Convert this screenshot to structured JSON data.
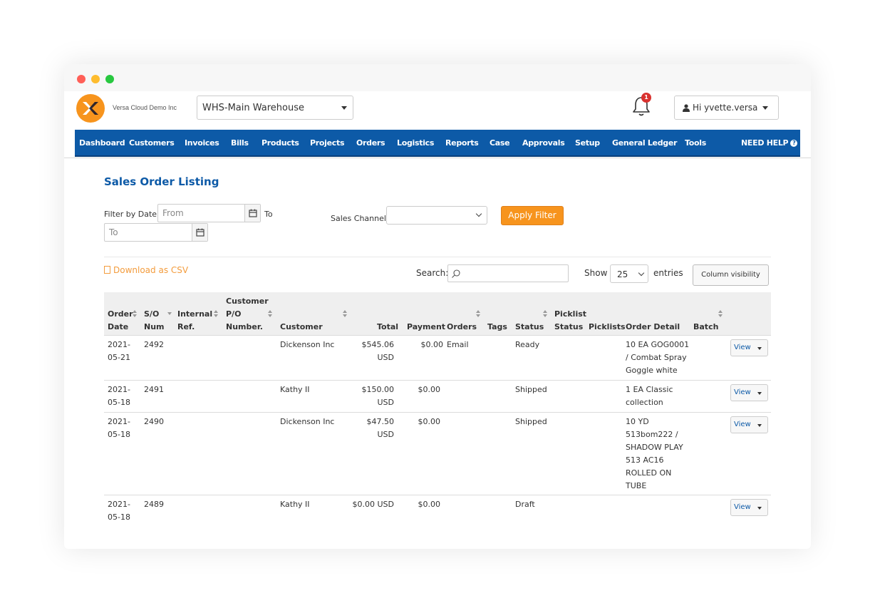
{
  "app": {
    "company": "Versa Cloud Demo Inc",
    "warehouse": "WHS-Main Warehouse",
    "notification_count": "1",
    "user_greeting": "Hi yvette.versa"
  },
  "nav": {
    "items": [
      "Dashboard",
      "Customers",
      "Invoices",
      "Bills",
      "Products",
      "Projects",
      "Orders",
      "Logistics",
      "Reports",
      "Case",
      "Approvals",
      "Setup",
      "General Ledger",
      "Tools"
    ],
    "help": "NEED HELP"
  },
  "page": {
    "title": "Sales Order Listing"
  },
  "filters": {
    "filter_by_date": "Filter by Date",
    "from_placeholder": "From",
    "to_label": "To",
    "to_placeholder": "To",
    "sales_channel": "Sales Channel",
    "apply": "Apply Filter"
  },
  "toolbar": {
    "download_csv": "Download as CSV",
    "search_label": "Search:",
    "show": "Show",
    "page_length": "25",
    "entries": "entries",
    "column_visibility": "Column visibility"
  },
  "table": {
    "headers": {
      "order_date": [
        "Order",
        "Date"
      ],
      "so_num": [
        "S/O",
        "Num"
      ],
      "internal_ref": [
        "Internal",
        "Ref."
      ],
      "customer_po": [
        "Customer",
        "P/O",
        "Number."
      ],
      "customer": "Customer",
      "total": "Total",
      "payment": "Payment",
      "orders": "Orders",
      "tags": "Tags",
      "status": "Status",
      "picklist_status": [
        "Picklist",
        "Status"
      ],
      "picklists": "Picklists",
      "order_detail": "Order Detail",
      "batch": "Batch"
    },
    "rows": [
      {
        "date": [
          "2021-",
          "05-21"
        ],
        "so": "2492",
        "customer": "Dickenson Inc",
        "total": [
          "$545.06",
          "USD"
        ],
        "payment": "$0.00",
        "orders": "Email",
        "status": "Ready",
        "detail": [
          "10 EA GOG0001",
          "/ Combat Spray",
          "Goggle white"
        ],
        "action": "View"
      },
      {
        "date": [
          "2021-",
          "05-18"
        ],
        "so": "2491",
        "customer": "Kathy II",
        "total": [
          "$150.00",
          "USD"
        ],
        "payment": "$0.00",
        "orders": "",
        "status": "Shipped",
        "detail": [
          "1 EA Classic",
          "collection"
        ],
        "action": "View"
      },
      {
        "date": [
          "2021-",
          "05-18"
        ],
        "so": "2490",
        "customer": "Dickenson Inc",
        "total": [
          "$47.50",
          "USD"
        ],
        "payment": "$0.00",
        "orders": "",
        "status": "Shipped",
        "detail": [
          "10 YD",
          "513bom222 /",
          "SHADOW PLAY",
          "513 AC16",
          "ROLLED ON",
          "TUBE"
        ],
        "action": "View"
      },
      {
        "date": [
          "2021-",
          "05-18"
        ],
        "so": "2489",
        "customer": "Kathy II",
        "total": [
          "$0.00 USD"
        ],
        "payment": "$0.00",
        "orders": "",
        "status": "Draft",
        "detail": [],
        "action": "View"
      }
    ]
  },
  "colors": {
    "nav": "#0d5aa7",
    "accent": "#f7941d",
    "title": "#0d5aa7",
    "csv": "#f39c3d"
  }
}
